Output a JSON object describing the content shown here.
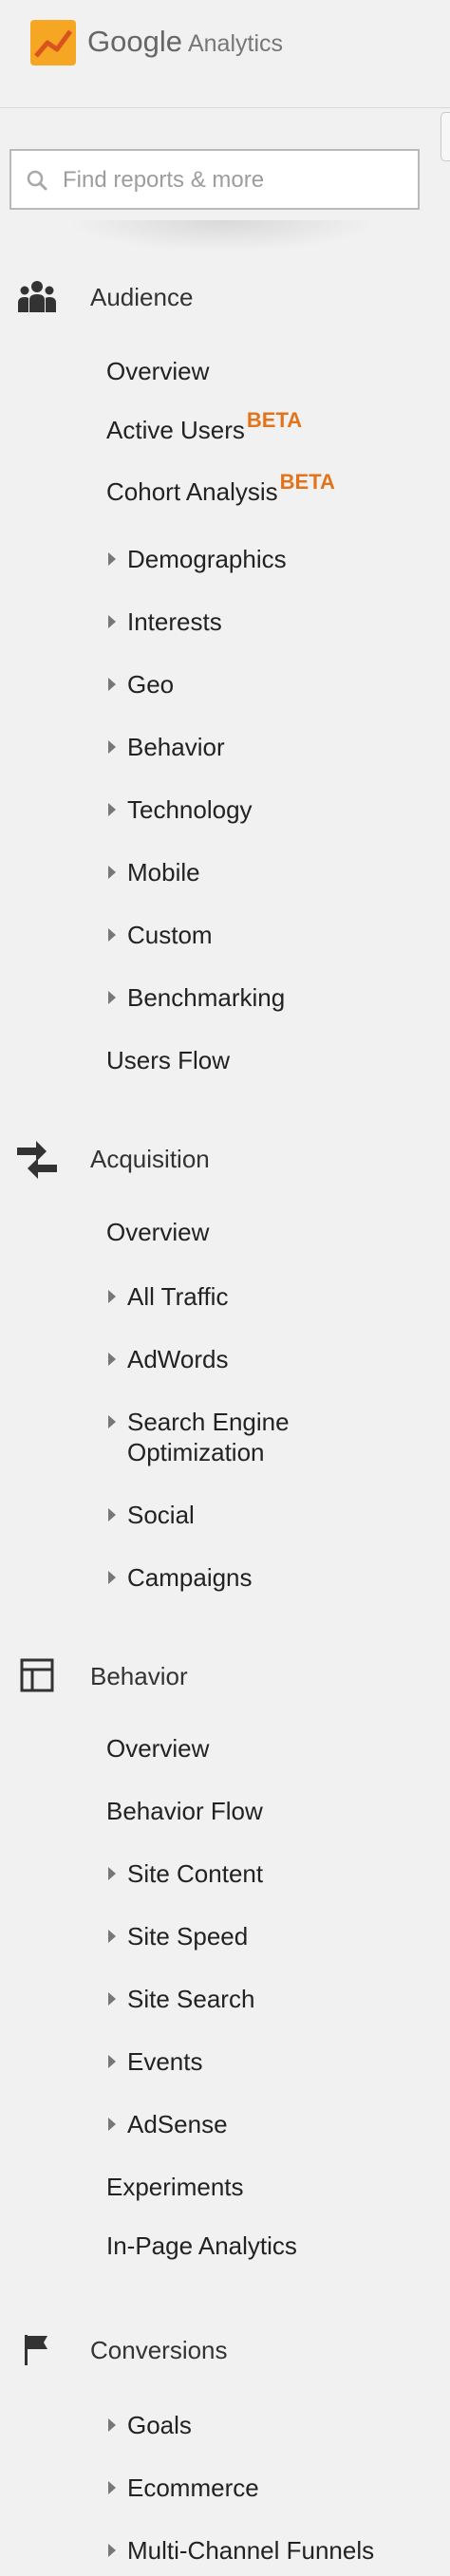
{
  "header": {
    "brand": "Google",
    "product": "Analytics"
  },
  "search": {
    "placeholder": "Find reports & more",
    "value": ""
  },
  "sections": {
    "audience": {
      "label": "Audience",
      "icon": "people-icon",
      "items": [
        {
          "label": "Overview"
        },
        {
          "label": "Active Users",
          "badge": "BETA"
        },
        {
          "label": "Cohort Analysis",
          "badge": "BETA"
        },
        {
          "label": "Demographics"
        },
        {
          "label": "Interests"
        },
        {
          "label": "Geo"
        },
        {
          "label": "Behavior"
        },
        {
          "label": "Technology"
        },
        {
          "label": "Mobile"
        },
        {
          "label": "Custom"
        },
        {
          "label": "Benchmarking"
        },
        {
          "label": "Users Flow"
        }
      ]
    },
    "acquisition": {
      "label": "Acquisition",
      "icon": "arrows-icon",
      "items": [
        {
          "label": "Overview"
        },
        {
          "label": "All Traffic"
        },
        {
          "label": "AdWords"
        },
        {
          "label": "Search Engine Optimization"
        },
        {
          "label": "Social"
        },
        {
          "label": "Campaigns"
        }
      ]
    },
    "behavior": {
      "label": "Behavior",
      "icon": "layout-icon",
      "items": [
        {
          "label": "Overview"
        },
        {
          "label": "Behavior Flow"
        },
        {
          "label": "Site Content"
        },
        {
          "label": "Site Speed"
        },
        {
          "label": "Site Search"
        },
        {
          "label": "Events"
        },
        {
          "label": "AdSense"
        },
        {
          "label": "Experiments"
        },
        {
          "label": "In-Page Analytics"
        }
      ]
    },
    "conversions": {
      "label": "Conversions",
      "icon": "flag-icon",
      "items": [
        {
          "label": "Goals"
        },
        {
          "label": "Ecommerce"
        },
        {
          "label": "Multi-Channel Funnels"
        }
      ]
    }
  },
  "colors": {
    "background": "#f1f1f1",
    "beta_badge": "#e3731b",
    "logo_orange": "#f5a623",
    "logo_dark_orange": "#e8710a"
  }
}
